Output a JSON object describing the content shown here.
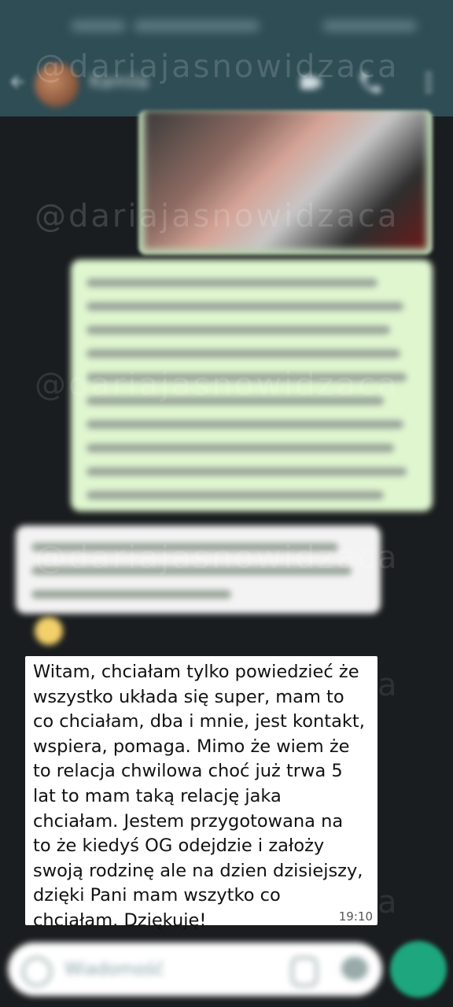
{
  "app": {
    "contact_name": "Kamila",
    "colors": {
      "header": "#2f4d55",
      "outgoing_bubble": "#dff6cf",
      "incoming_bubble": "#ffffff",
      "mic": "#1ea67e",
      "background": "#1a1d1f"
    }
  },
  "header": {
    "icons": {
      "back": "arrow-left",
      "video": "video-camera",
      "call": "phone",
      "more": "vertical-dots"
    }
  },
  "watermark": {
    "text": "@dariajasnowidzaca"
  },
  "message": {
    "text": "Witam, chciałam tylko powiedzieć że\nwszystko układa się super, mam to\nco chciałam, dba i mnie, jest kontakt,\nwspiera, pomaga. Mimo że wiem że\nto relacja chwilowa choć już trwa 5\nlat to mam taką relację jaka\nchciałam. Jestem przygotowana na\nto że kiedyś OG odejdzie i założy\nswoją rodzinę ale na dzien dzisiejszy,\ndzięki Pani mam wszytko co\nchciałam. Dziękuję!",
    "time": "19:10"
  },
  "input": {
    "placeholder": "Wiadomość"
  }
}
